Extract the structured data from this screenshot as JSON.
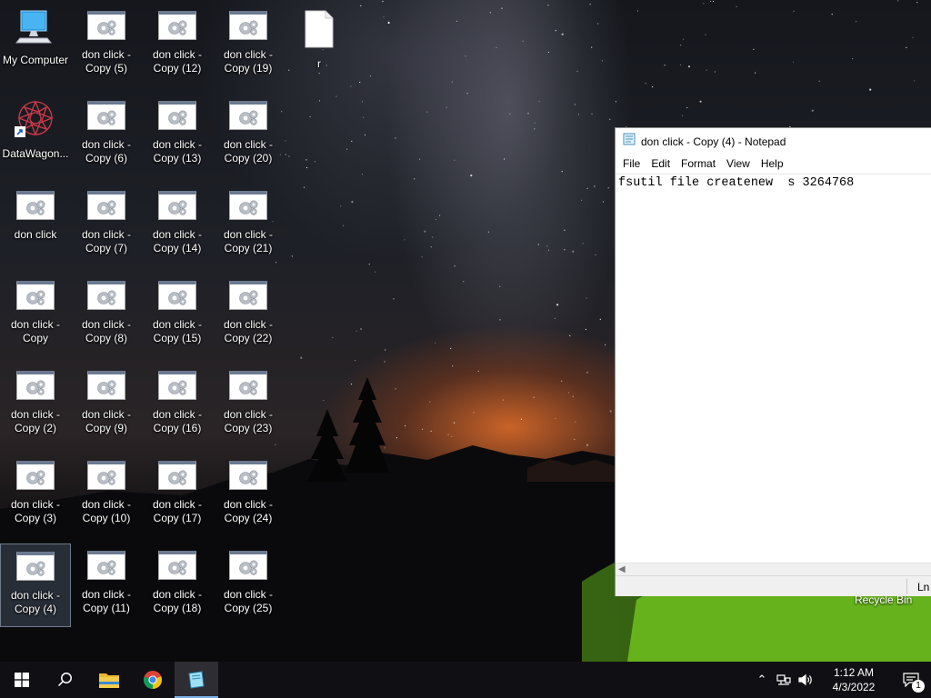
{
  "desktop": {
    "icons": [
      {
        "label": "My Computer",
        "kind": "computer"
      },
      {
        "label": "DataWagon...",
        "kind": "shortcut"
      },
      {
        "label": "don click",
        "kind": "gear"
      },
      {
        "label": "don click -\nCopy",
        "kind": "gear"
      },
      {
        "label": "don click -\nCopy (2)",
        "kind": "gear"
      },
      {
        "label": "don click -\nCopy (3)",
        "kind": "gear"
      },
      {
        "label": "don click -\nCopy (4)",
        "kind": "gear",
        "selected": true
      },
      {
        "label": "don click -\nCopy (5)",
        "kind": "gear"
      },
      {
        "label": "don click -\nCopy (6)",
        "kind": "gear"
      },
      {
        "label": "don click -\nCopy (7)",
        "kind": "gear"
      },
      {
        "label": "don click -\nCopy (8)",
        "kind": "gear"
      },
      {
        "label": "don click -\nCopy (9)",
        "kind": "gear"
      },
      {
        "label": "don click -\nCopy (10)",
        "kind": "gear"
      },
      {
        "label": "don click -\nCopy (11)",
        "kind": "gear"
      },
      {
        "label": "don click -\nCopy (12)",
        "kind": "gear"
      },
      {
        "label": "don click -\nCopy (13)",
        "kind": "gear"
      },
      {
        "label": "don click -\nCopy (14)",
        "kind": "gear"
      },
      {
        "label": "don click -\nCopy (15)",
        "kind": "gear"
      },
      {
        "label": "don click -\nCopy (16)",
        "kind": "gear"
      },
      {
        "label": "don click -\nCopy (17)",
        "kind": "gear"
      },
      {
        "label": "don click -\nCopy (18)",
        "kind": "gear"
      },
      {
        "label": "don click -\nCopy (19)",
        "kind": "gear"
      },
      {
        "label": "don click -\nCopy (20)",
        "kind": "gear"
      },
      {
        "label": "don click -\nCopy (21)",
        "kind": "gear"
      },
      {
        "label": "don click -\nCopy (22)",
        "kind": "gear"
      },
      {
        "label": "don click -\nCopy (23)",
        "kind": "gear"
      },
      {
        "label": "don click -\nCopy (24)",
        "kind": "gear"
      },
      {
        "label": "don click -\nCopy (25)",
        "kind": "gear"
      },
      {
        "label": "r",
        "kind": "file"
      }
    ],
    "recycle_bin_label": "Recycle Bin"
  },
  "notepad": {
    "title": "don click - Copy (4) - Notepad",
    "menu": [
      "File",
      "Edit",
      "Format",
      "View",
      "Help"
    ],
    "content": "fsutil file createnew  s 3264768",
    "status_position": "Ln"
  },
  "taskbar": {
    "apps": [
      "start-icon",
      "search-icon",
      "file-explorer-icon",
      "chrome-icon",
      "notepad-icon"
    ],
    "active_app": "notepad-icon",
    "time": "1:12 AM",
    "date": "4/3/2022",
    "notification_count": "1"
  },
  "colors": {
    "taskbar": "#101014",
    "active_indicator": "#7cb3e8",
    "selection": "#788caa"
  }
}
